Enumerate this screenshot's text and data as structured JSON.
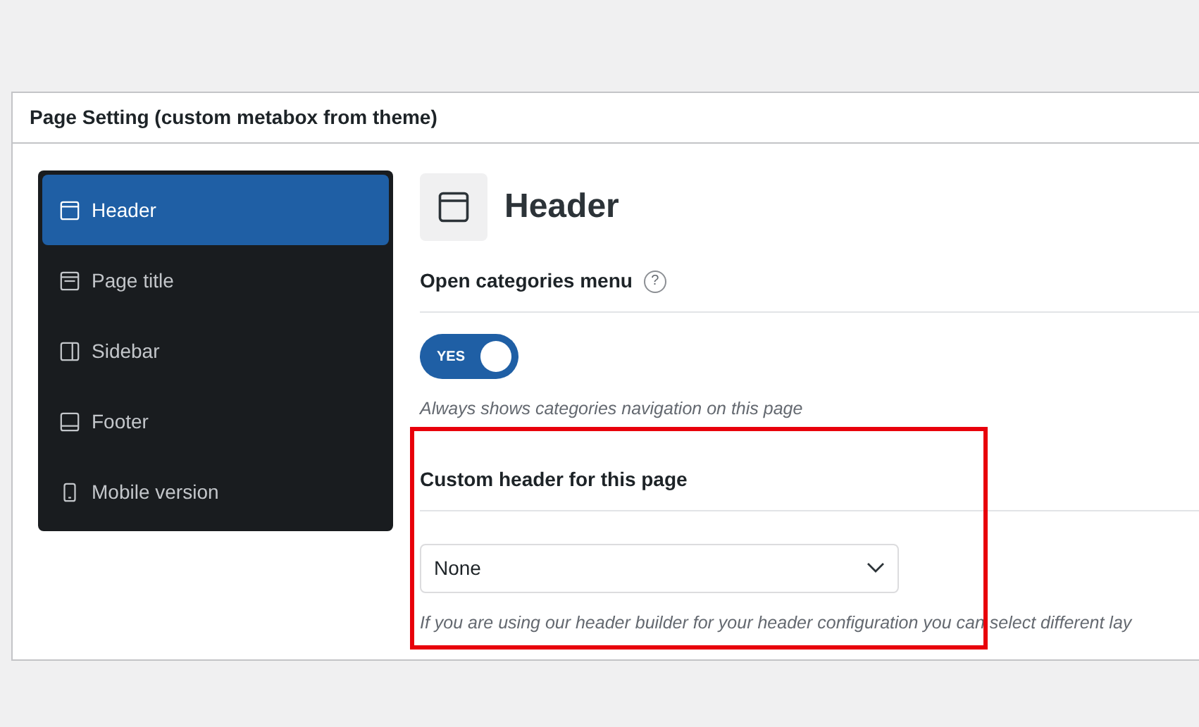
{
  "panel": {
    "title": "Page Setting (custom metabox from theme)"
  },
  "sidebar": {
    "items": [
      {
        "label": "Header",
        "kind": "header",
        "selected": true
      },
      {
        "label": "Page title",
        "kind": "title",
        "selected": false
      },
      {
        "label": "Sidebar",
        "kind": "sidebar",
        "selected": false
      },
      {
        "label": "Footer",
        "kind": "footer",
        "selected": false
      },
      {
        "label": "Mobile version",
        "kind": "mobile",
        "selected": false
      }
    ]
  },
  "section": {
    "title": "Header"
  },
  "fields": [
    {
      "kind": "toggle",
      "label": "Open categories menu",
      "help": "?",
      "on": true,
      "toggle_text": "YES",
      "description": "Always shows categories navigation on this page",
      "highlighted": false
    },
    {
      "kind": "select",
      "label": "Custom header for this page",
      "value": "None",
      "description": "If you are using our header builder for your header configuration you can select different lay",
      "highlighted": true
    }
  ]
}
